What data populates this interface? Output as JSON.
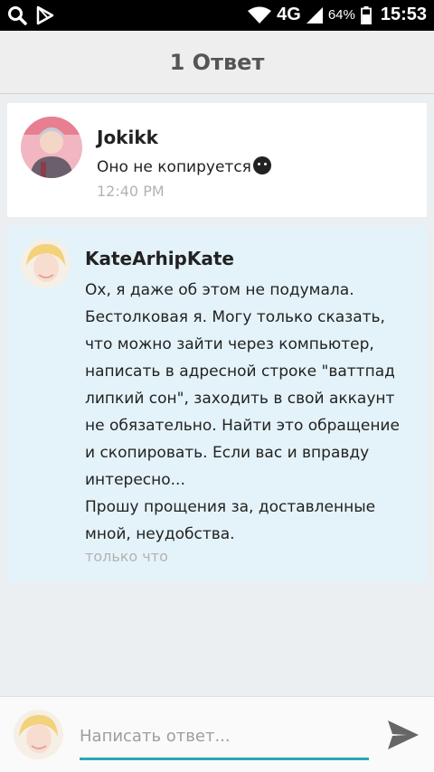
{
  "status_bar": {
    "network": "4G",
    "battery": "64%",
    "time": "15:53"
  },
  "header": {
    "title": "1 Ответ"
  },
  "comments": [
    {
      "author": "Jokikk",
      "text": "Оно не копируется",
      "time": "12:40 PM"
    },
    {
      "author": "KateArhipKate",
      "lines": [
        "Ох, я даже об этом не подумала.",
        "Бестолковая я. Могу только сказать,",
        "что можно зайти через компьютер,",
        "написать в адресной строке \"ваттпад",
        "липкий сон\", заходить в свой аккаунт",
        "не обязательно. Найти это обращение",
        "и скопировать. Если вас и вправду",
        "интересно...",
        "Прошу прощения за, доставленные",
        "мной, неудобства."
      ],
      "time": "только что"
    }
  ],
  "composer": {
    "placeholder": "Написать ответ..."
  },
  "colors": {
    "accent": "#26a8b6",
    "reply_bg": "#e4f3f9"
  }
}
